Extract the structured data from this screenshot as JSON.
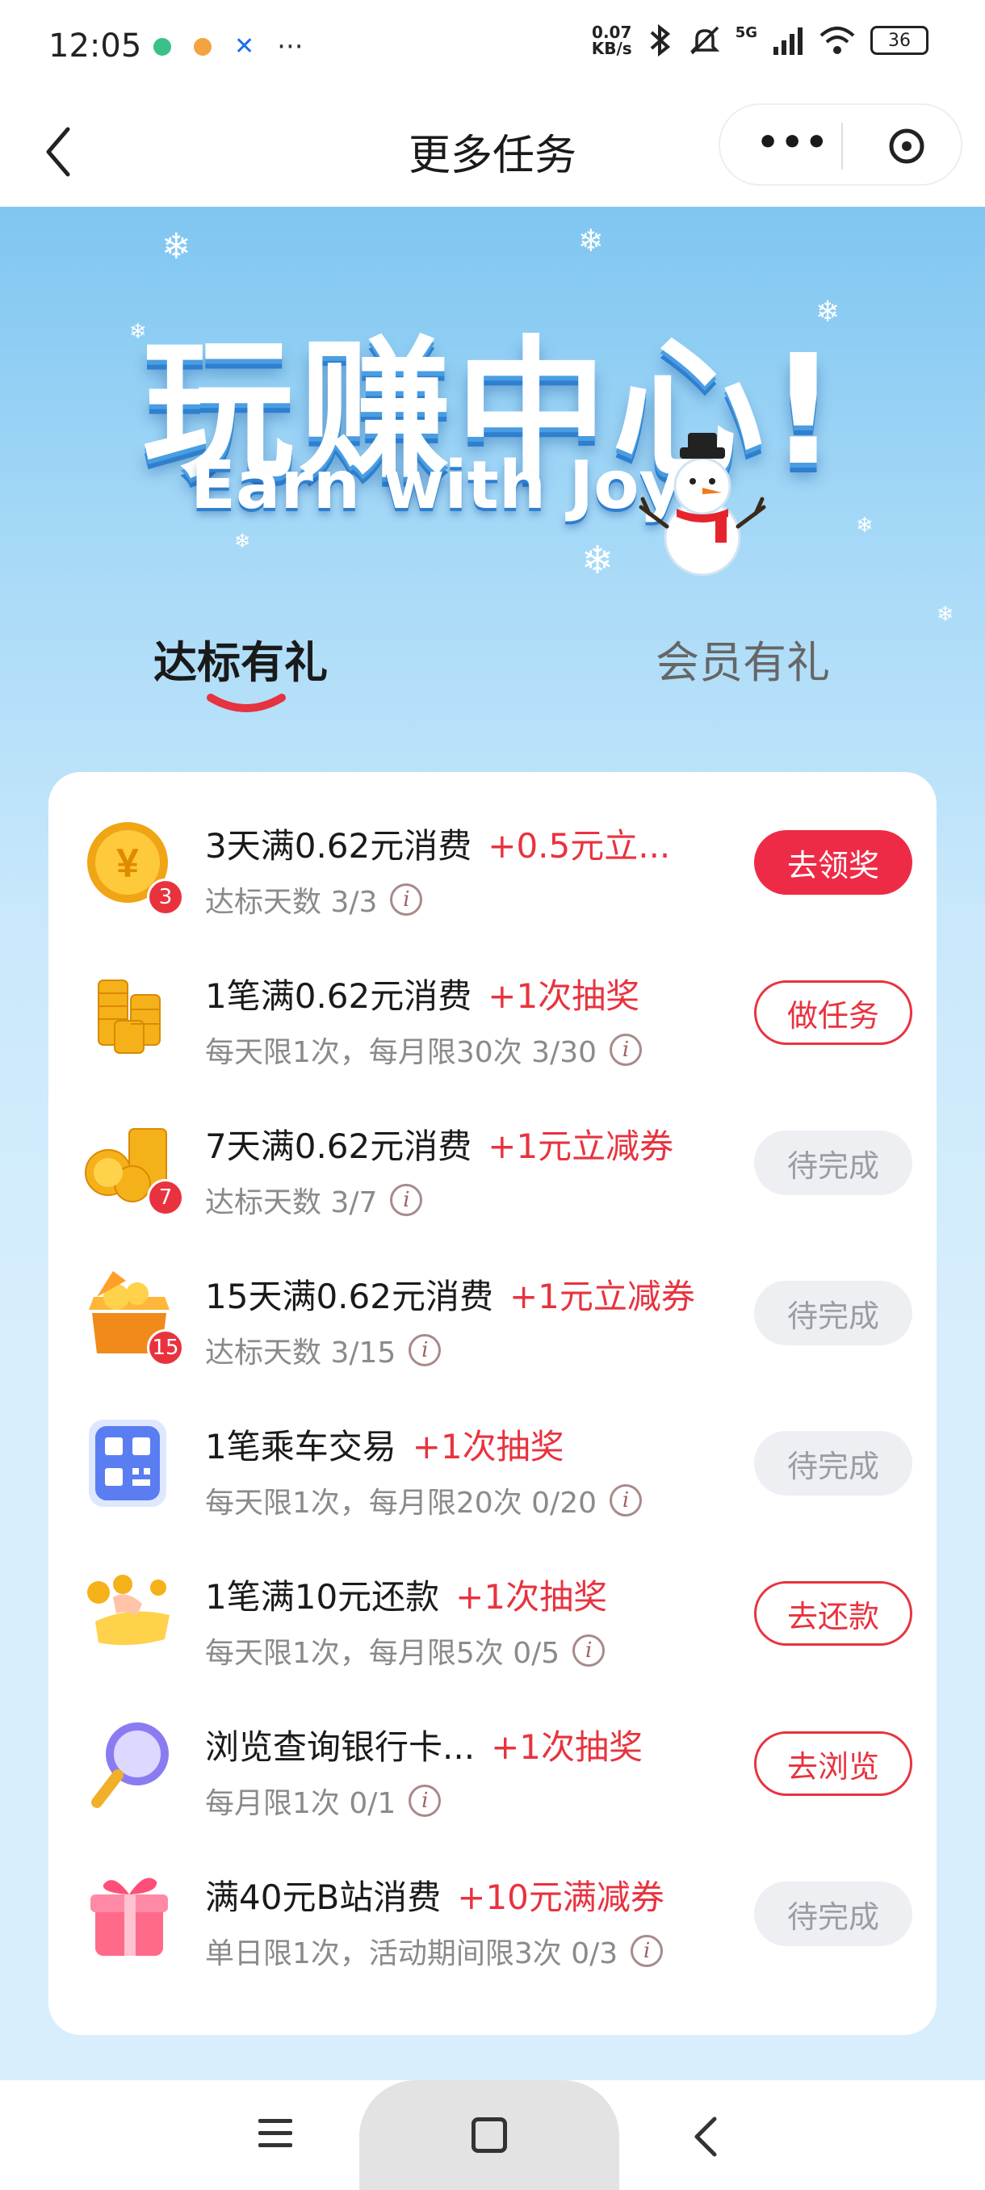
{
  "status_bar": {
    "time": "12:05",
    "net_speed_value": "0.07",
    "net_speed_unit": "KB/s",
    "signal_label": "5G",
    "battery": "36",
    "more": "···",
    "icons": [
      "app-notify-green-icon",
      "app-notify-orange-icon",
      "x-app-icon",
      "bluetooth-icon",
      "mute-icon",
      "signal-icon",
      "wifi-icon",
      "battery-icon"
    ]
  },
  "nav": {
    "title": "更多任务",
    "more": "•••"
  },
  "hero": {
    "title": "玩赚中心!",
    "subtitle": "Earn with Joy"
  },
  "tabs": [
    {
      "label": "达标有礼",
      "active": true
    },
    {
      "label": "会员有礼",
      "active": false
    }
  ],
  "tasks": [
    {
      "icon": "coin-icon",
      "badge": "3",
      "title": "3天满0.62元消费",
      "reward": "+0.5元立...",
      "sub": "达标天数 3/3",
      "button": "去领奖",
      "button_style": "solid"
    },
    {
      "icon": "coin-stack-icon",
      "badge": "",
      "title": "1笔满0.62元消费",
      "reward": "+1次抽奖",
      "sub": "每天限1次，每月限30次 3/30",
      "button": "做任务",
      "button_style": "outline"
    },
    {
      "icon": "coin-pile-icon",
      "badge": "7",
      "title": "7天满0.62元消费",
      "reward": "+1元立减券",
      "sub": "达标天数 3/7",
      "button": "待完成",
      "button_style": "disabled"
    },
    {
      "icon": "treasure-box-icon",
      "badge": "15",
      "title": "15天满0.62元消费",
      "reward": "+1元立减券",
      "sub": "达标天数 3/15",
      "button": "待完成",
      "button_style": "disabled"
    },
    {
      "icon": "qr-code-icon",
      "badge": "",
      "title": "1笔乘车交易",
      "reward": "+1次抽奖",
      "sub": "每天限1次，每月限20次 0/20",
      "button": "待完成",
      "button_style": "disabled"
    },
    {
      "icon": "hand-coins-icon",
      "badge": "",
      "title": "1笔满10元还款",
      "reward": "+1次抽奖",
      "sub": "每天限1次，每月限5次 0/5",
      "button": "去还款",
      "button_style": "outline"
    },
    {
      "icon": "magnifier-icon",
      "badge": "",
      "title": "浏览查询银行卡...",
      "reward": "+1次抽奖",
      "sub": "每月限1次 0/1",
      "button": "去浏览",
      "button_style": "outline"
    },
    {
      "icon": "gift-box-icon",
      "badge": "",
      "title": "满40元B站消费",
      "reward": "+10元满减券",
      "sub": "单日限1次，活动期间限3次 0/3",
      "button": "待完成",
      "button_style": "disabled"
    }
  ],
  "info_glyph": "i",
  "colors": {
    "accent_red": "#e8333f",
    "button_red": "#ee2b46",
    "hero_blue": "#7fc6f1",
    "disabled_bg": "#eeeff3"
  }
}
